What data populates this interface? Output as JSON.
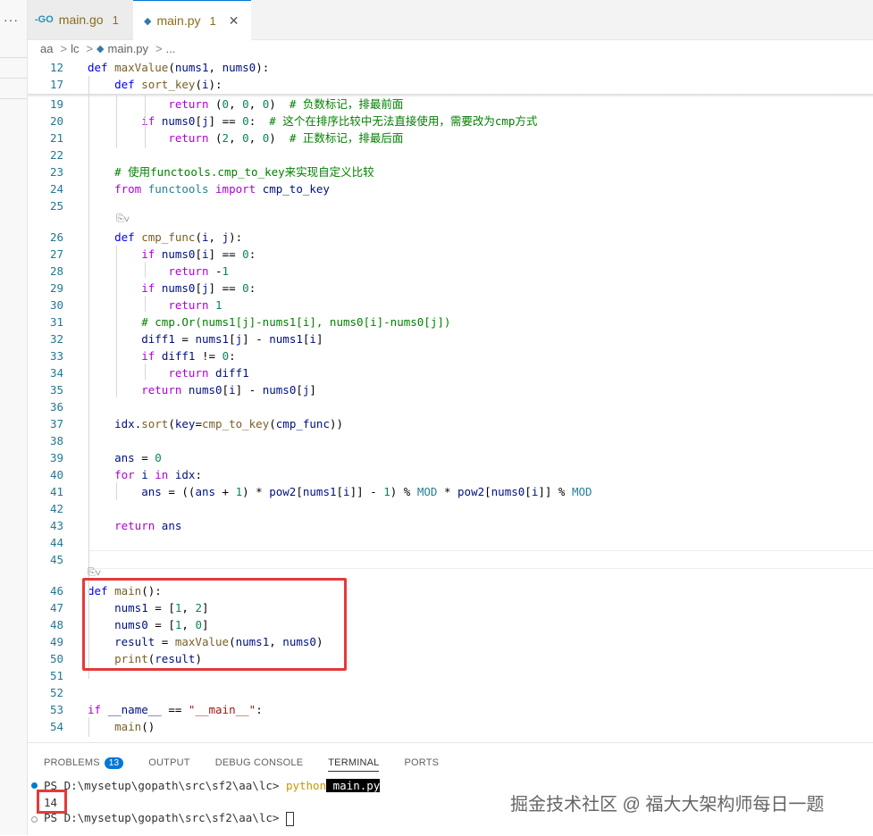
{
  "window": {
    "overflow_dots": "···"
  },
  "tabs": [
    {
      "icon": "-GO",
      "label": "main.go",
      "problems": "1"
    },
    {
      "icon": "◆",
      "label": "main.py",
      "problems": "1",
      "close": "✕"
    }
  ],
  "breadcrumb": {
    "folder": "aa",
    "sub": "lc",
    "file": "main.py",
    "more": "..."
  },
  "code_lines": [
    {
      "n": "12",
      "t": "def maxValue(nums1, nums0):"
    },
    {
      "n": "17",
      "t": "    def sort_key(i):"
    },
    {
      "n": "19",
      "t": "            return (0, 0, 0)  # 负数标记，排最前面"
    },
    {
      "n": "20",
      "t": "        if nums0[j] == 0:  # 这个在排序比较中无法直接使用，需要改为cmp方式"
    },
    {
      "n": "21",
      "t": "            return (2, 0, 0)  # 正数标记，排最后面"
    },
    {
      "n": "22",
      "t": ""
    },
    {
      "n": "23",
      "t": "    # 使用functools.cmp_to_key来实现自定义比较"
    },
    {
      "n": "24",
      "t": "    from functools import cmp_to_key"
    },
    {
      "n": "25",
      "t": ""
    },
    {
      "n": "26",
      "t": "    def cmp_func(i, j):"
    },
    {
      "n": "27",
      "t": "        if nums0[i] == 0:"
    },
    {
      "n": "28",
      "t": "            return -1"
    },
    {
      "n": "29",
      "t": "        if nums0[j] == 0:"
    },
    {
      "n": "30",
      "t": "            return 1"
    },
    {
      "n": "31",
      "t": "        # cmp.Or(nums1[j]-nums1[i], nums0[i]-nums0[j])"
    },
    {
      "n": "32",
      "t": "        diff1 = nums1[j] - nums1[i]"
    },
    {
      "n": "33",
      "t": "        if diff1 != 0:"
    },
    {
      "n": "34",
      "t": "            return diff1"
    },
    {
      "n": "35",
      "t": "        return nums0[i] - nums0[j]"
    },
    {
      "n": "36",
      "t": ""
    },
    {
      "n": "37",
      "t": "    idx.sort(key=cmp_to_key(cmp_func))"
    },
    {
      "n": "38",
      "t": ""
    },
    {
      "n": "39",
      "t": "    ans = 0"
    },
    {
      "n": "40",
      "t": "    for i in idx:"
    },
    {
      "n": "41",
      "t": "        ans = ((ans + 1) * pow2[nums1[i]] - 1) % MOD * pow2[nums0[i]] % MOD"
    },
    {
      "n": "42",
      "t": ""
    },
    {
      "n": "43",
      "t": "    return ans"
    },
    {
      "n": "44",
      "t": ""
    },
    {
      "n": "45",
      "t": ""
    },
    {
      "n": "46",
      "t": "def main():"
    },
    {
      "n": "47",
      "t": "    nums1 = [1, 2]"
    },
    {
      "n": "48",
      "t": "    nums0 = [1, 0]"
    },
    {
      "n": "49",
      "t": "    result = maxValue(nums1, nums0)"
    },
    {
      "n": "50",
      "t": "    print(result)"
    },
    {
      "n": "51",
      "t": ""
    },
    {
      "n": "52",
      "t": ""
    },
    {
      "n": "53",
      "t": "if __name__ == \"__main__\":"
    },
    {
      "n": "54",
      "t": "    main()"
    }
  ],
  "codelens": "⎘∨",
  "panel": {
    "tabs": [
      "PROBLEMS",
      "OUTPUT",
      "DEBUG CONSOLE",
      "TERMINAL",
      "PORTS"
    ],
    "problems_count": "13",
    "terminal": {
      "prompt1": "PS D:\\mysetup\\gopath\\src\\sf2\\aa\\lc> ",
      "cmd": "python",
      "arg": " main.py",
      "output": "14",
      "prompt2": "PS D:\\mysetup\\gopath\\src\\sf2\\aa\\lc> "
    }
  },
  "watermark": "掘金技术社区 @ 福大大架构师每日一题",
  "colors": {
    "accent": "#0078d4",
    "highlight_box": "#e5393a"
  }
}
